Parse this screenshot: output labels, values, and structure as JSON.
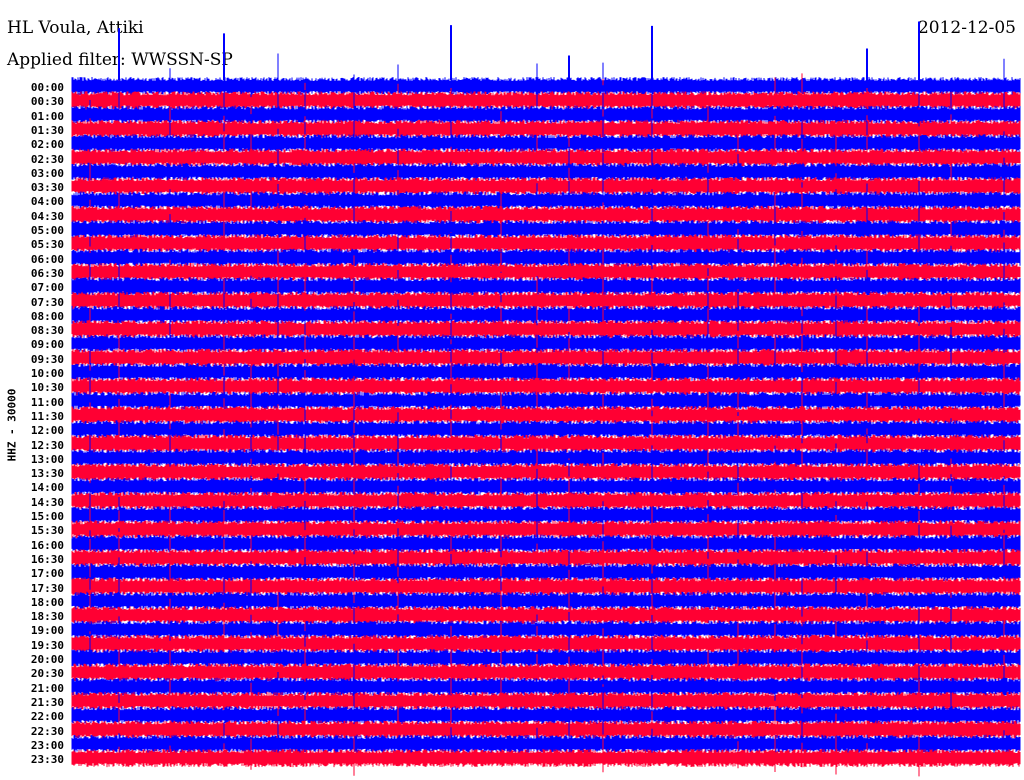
{
  "header": {
    "station": "HL Voula, Attiki",
    "filter": "Applied filter: WWSSN-SP",
    "date": "2012-12-05"
  },
  "chart_data": {
    "type": "line",
    "title": "HL Voula, Attiki",
    "subtitle": "Applied filter: WWSSN-SP",
    "ylabel": "HHZ - 30000",
    "xlabel": "",
    "row_duration_minutes": 30,
    "row_labels": [
      "00:00",
      "00:30",
      "01:00",
      "01:30",
      "02:00",
      "02:30",
      "03:00",
      "03:30",
      "04:00",
      "04:30",
      "05:00",
      "05:30",
      "06:00",
      "06:30",
      "07:00",
      "07:30",
      "08:00",
      "08:30",
      "09:00",
      "09:30",
      "10:00",
      "10:30",
      "11:00",
      "11:30",
      "12:00",
      "12:30",
      "13:00",
      "13:30",
      "14:00",
      "14:30",
      "15:00",
      "15:30",
      "16:00",
      "16:30",
      "17:00",
      "17:30",
      "18:00",
      "18:30",
      "19:00",
      "19:30",
      "20:00",
      "20:30",
      "21:00",
      "21:30",
      "22:00",
      "22:30",
      "23:00",
      "23:30"
    ],
    "series_colors": [
      "#0000ff",
      "#ff0033"
    ],
    "grid": false
  }
}
